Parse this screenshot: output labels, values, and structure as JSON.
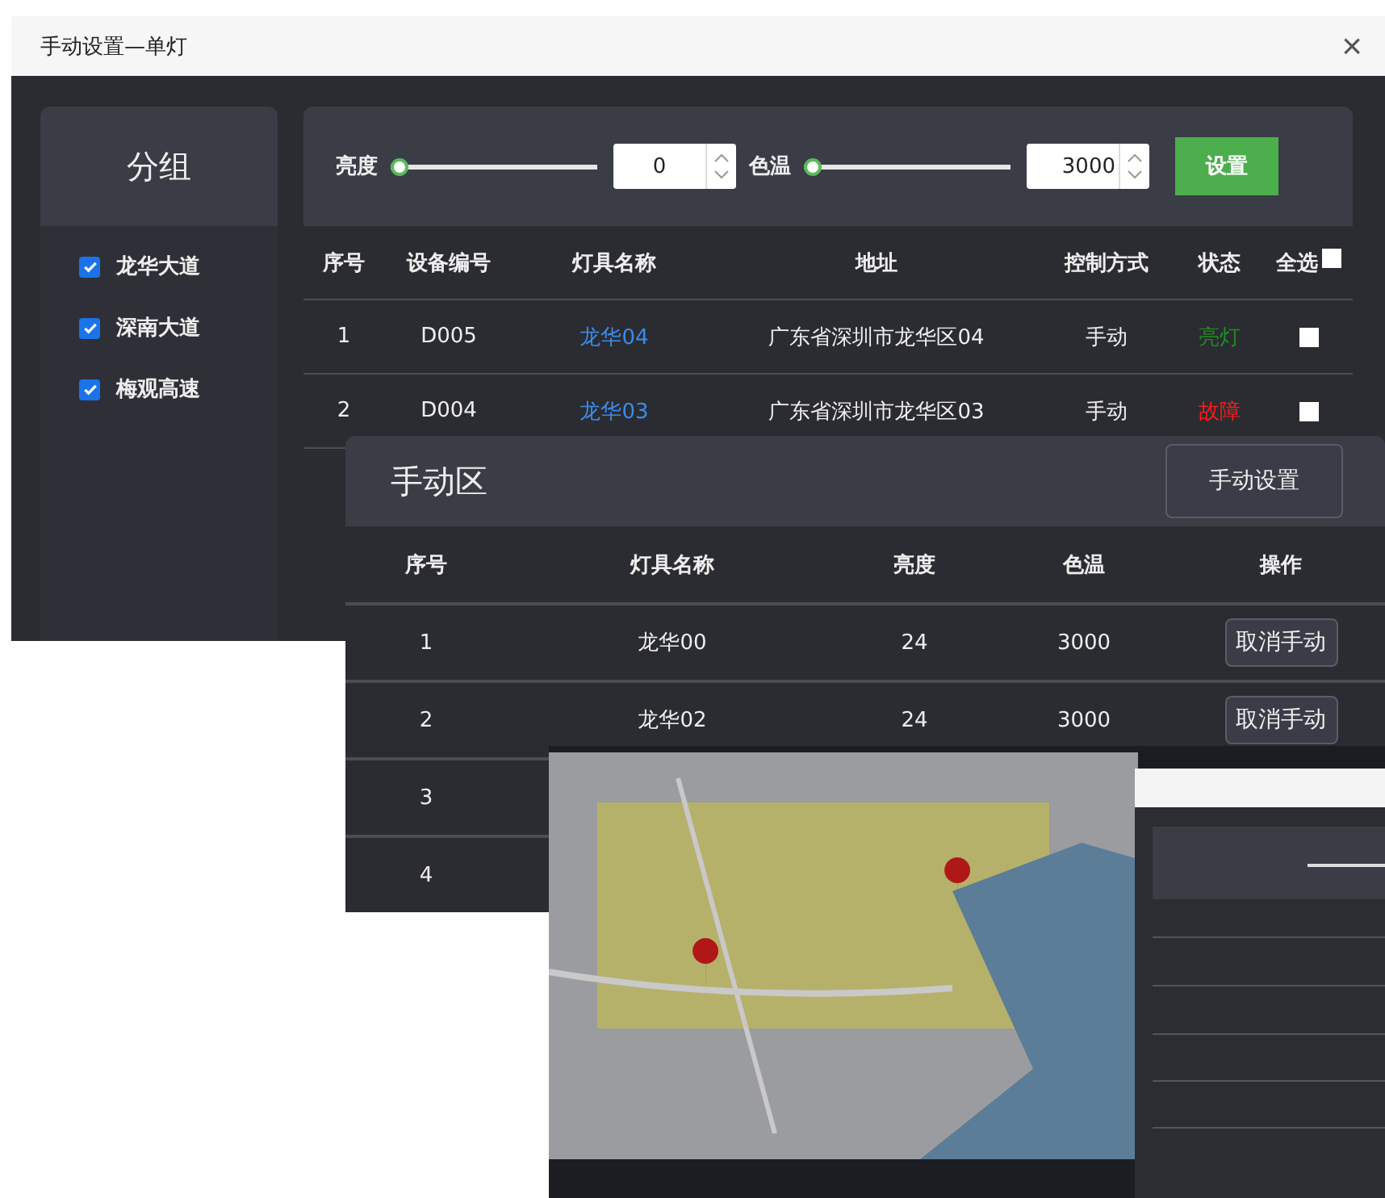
{
  "main_window": {
    "title": "手动设置—单灯",
    "close": "×",
    "groups": {
      "title": "分组",
      "items": [
        {
          "label": "龙华大道",
          "checked": true
        },
        {
          "label": "深南大道",
          "checked": true
        },
        {
          "label": "梅观高速",
          "checked": true
        }
      ]
    },
    "toolbar": {
      "brightness": {
        "label": "亮度",
        "level": 0,
        "value": "0"
      },
      "color_temp": {
        "label": "色温",
        "level": 0,
        "value": "3000"
      },
      "set_button": "设置"
    },
    "table": {
      "columns": [
        "序号",
        "设备编号",
        "灯具名称",
        "地址",
        "控制方式",
        "状态",
        "全选"
      ],
      "select_all": false,
      "rows": [
        {
          "index": "1",
          "device": "D005",
          "name": "龙华04",
          "address": "广东省深圳市龙华区04",
          "mode": "手动",
          "status": "亮灯",
          "color": "#1e8c1e",
          "checked": false
        },
        {
          "index": "2",
          "device": "D004",
          "name": "龙华03",
          "address": "广东省深圳市龙华区03",
          "mode": "手动",
          "status": "故障",
          "color": "#ff1a1a",
          "checked": false
        }
      ]
    }
  },
  "manual_window": {
    "title": "手动区",
    "settings_button": "手动设置",
    "table": {
      "columns": [
        "序号",
        "灯具名称",
        "亮度",
        "色温",
        "操作"
      ],
      "rows": [
        {
          "index": "1",
          "name": "龙华00",
          "brightness": "24",
          "color_temp": "3000",
          "action": "取消手动"
        },
        {
          "index": "2",
          "name": "龙华02",
          "brightness": "24",
          "color_temp": "3000",
          "action": "取消手动"
        },
        {
          "index": "3"
        },
        {
          "index": "4"
        }
      ]
    }
  }
}
